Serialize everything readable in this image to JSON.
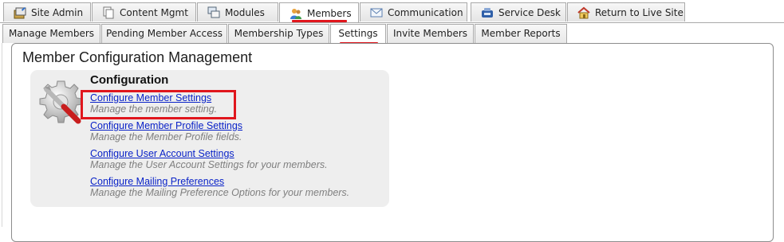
{
  "top_tabs": [
    {
      "label": "Site Admin",
      "icon": "site-admin-icon"
    },
    {
      "label": "Content Mgmt",
      "icon": "content-mgmt-icon"
    },
    {
      "label": "Modules",
      "icon": "modules-icon"
    },
    {
      "label": "Members",
      "icon": "members-icon",
      "active": true
    },
    {
      "label": "Communication",
      "icon": "envelope-icon"
    },
    {
      "label": "Service Desk",
      "icon": "service-desk-icon"
    },
    {
      "label": "Return to Live Site",
      "icon": "home-icon"
    }
  ],
  "sub_tabs": [
    {
      "label": "Manage Members"
    },
    {
      "label": "Pending Member Access"
    },
    {
      "label": "Membership Types"
    },
    {
      "label": "Settings",
      "active": true
    },
    {
      "label": "Invite Members"
    },
    {
      "label": "Member Reports"
    }
  ],
  "panel": {
    "title": "Member Configuration Management",
    "section_heading": "Configuration",
    "items": [
      {
        "link": "Configure Member Settings",
        "description": "Manage the member setting."
      },
      {
        "link": "Configure Member Profile Settings",
        "description": "Manage the Member Profile fields."
      },
      {
        "link": "Configure User Account Settings",
        "description": "Manage the User Account Settings for your members."
      },
      {
        "link": "Configure Mailing Preferences",
        "description": "Manage the Mailing Preference Options for your members."
      }
    ]
  },
  "colors": {
    "annotation_red": "#e0161d",
    "link_blue": "#0a23c8",
    "description_gray": "#7f7f7f",
    "tab_border": "#a9a9a9"
  }
}
